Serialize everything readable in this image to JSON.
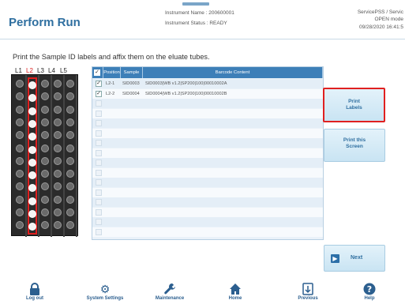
{
  "header": {
    "title": "Perform Run",
    "instrument_name": "Instrument Name : 200600001",
    "instrument_status": "Instrument Status : READY",
    "user": "ServicePSS / Servic",
    "mode": "OPEN mode",
    "datetime": "09/28/2020 16:41:5"
  },
  "instruction": "Print the Sample ID labels and affix them on the eluate tubes.",
  "rack": {
    "lanes": [
      "L1",
      "L2",
      "L3",
      "L4",
      "L5"
    ],
    "active_lane": "L2"
  },
  "table": {
    "columns": [
      "Position",
      "Sample ID",
      "Barcode Content"
    ],
    "rows": [
      {
        "checked": true,
        "position": "L2-1",
        "sample_id": "SID0003",
        "barcode": "SID0003|WB v1.2|SP200|100|00010002A"
      },
      {
        "checked": true,
        "position": "L2-2",
        "sample_id": "SID0004",
        "barcode": "SID0004|WB v1.2|SP200|100|00010002B"
      }
    ]
  },
  "buttons": {
    "print_labels_line1": "Print",
    "print_labels_line2": "Labels",
    "print_screen_line1": "Print this",
    "print_screen_line2": "Screen",
    "next": "Next"
  },
  "footer": {
    "logout": "Log out",
    "system_settings": "System Settings",
    "maintenance": "Maintenance",
    "home": "Home",
    "previous": "Previous",
    "help": "Help"
  },
  "icons": {
    "logout": "lock-icon",
    "system_settings": "gear-icon",
    "maintenance": "wrench-icon",
    "home": "home-icon",
    "previous": "previous-icon",
    "help": "help-icon",
    "next": "arrow-right-icon"
  },
  "colors": {
    "accent": "#2f6fa0",
    "table_header": "#3d7fb8",
    "highlight": "#e02020"
  }
}
